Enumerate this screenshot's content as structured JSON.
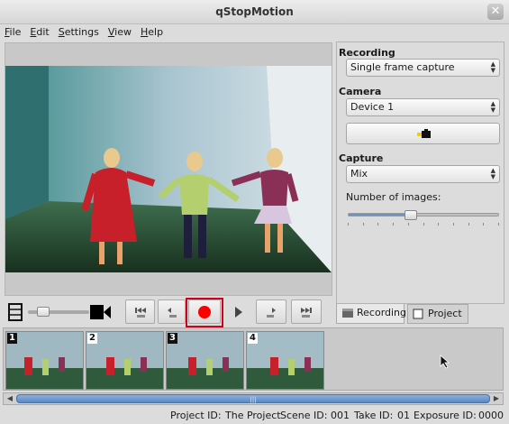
{
  "window": {
    "title": "qStopMotion",
    "close_glyph": "✕"
  },
  "menu": [
    {
      "underline": "F",
      "rest": "ile"
    },
    {
      "underline": "E",
      "rest": "dit"
    },
    {
      "underline": "S",
      "rest": "ettings"
    },
    {
      "underline": "V",
      "rest": "iew"
    },
    {
      "underline": "H",
      "rest": "elp"
    }
  ],
  "panel": {
    "recording_label": "Recording",
    "recording_mode": "Single frame capture",
    "camera_label": "Camera",
    "camera_device": "Device 1",
    "camera_button_icon": "camera-settings-icon",
    "capture_label": "Capture",
    "capture_mode": "Mix",
    "number_label": "Number of images:",
    "number_slider_fraction": 0.41
  },
  "tabs": {
    "recording": "Recording",
    "project": "Project"
  },
  "controls": {
    "icons": [
      "filmstrip-icon",
      "video-camera-icon",
      "skip-to-start-icon",
      "previous-frame-icon",
      "record-icon",
      "play-icon",
      "next-frame-icon",
      "skip-to-end-icon"
    ],
    "mix_slider_fraction": 0.15,
    "record_color": "#ff0000",
    "highlight_color": "#d0021b"
  },
  "frames": [
    {
      "number": "1"
    },
    {
      "number": "2"
    },
    {
      "number": "3"
    },
    {
      "number": "4"
    }
  ],
  "scrollbar": {
    "grip": "|||"
  },
  "status": {
    "project_id": "Project ID:",
    "project_name": "The Project",
    "scene_id": "Scene ID:",
    "scene_value": "001",
    "take_id": "Take ID:",
    "take_value": "01",
    "exposure_id": "Exposure ID:",
    "exposure_value": "0000"
  }
}
